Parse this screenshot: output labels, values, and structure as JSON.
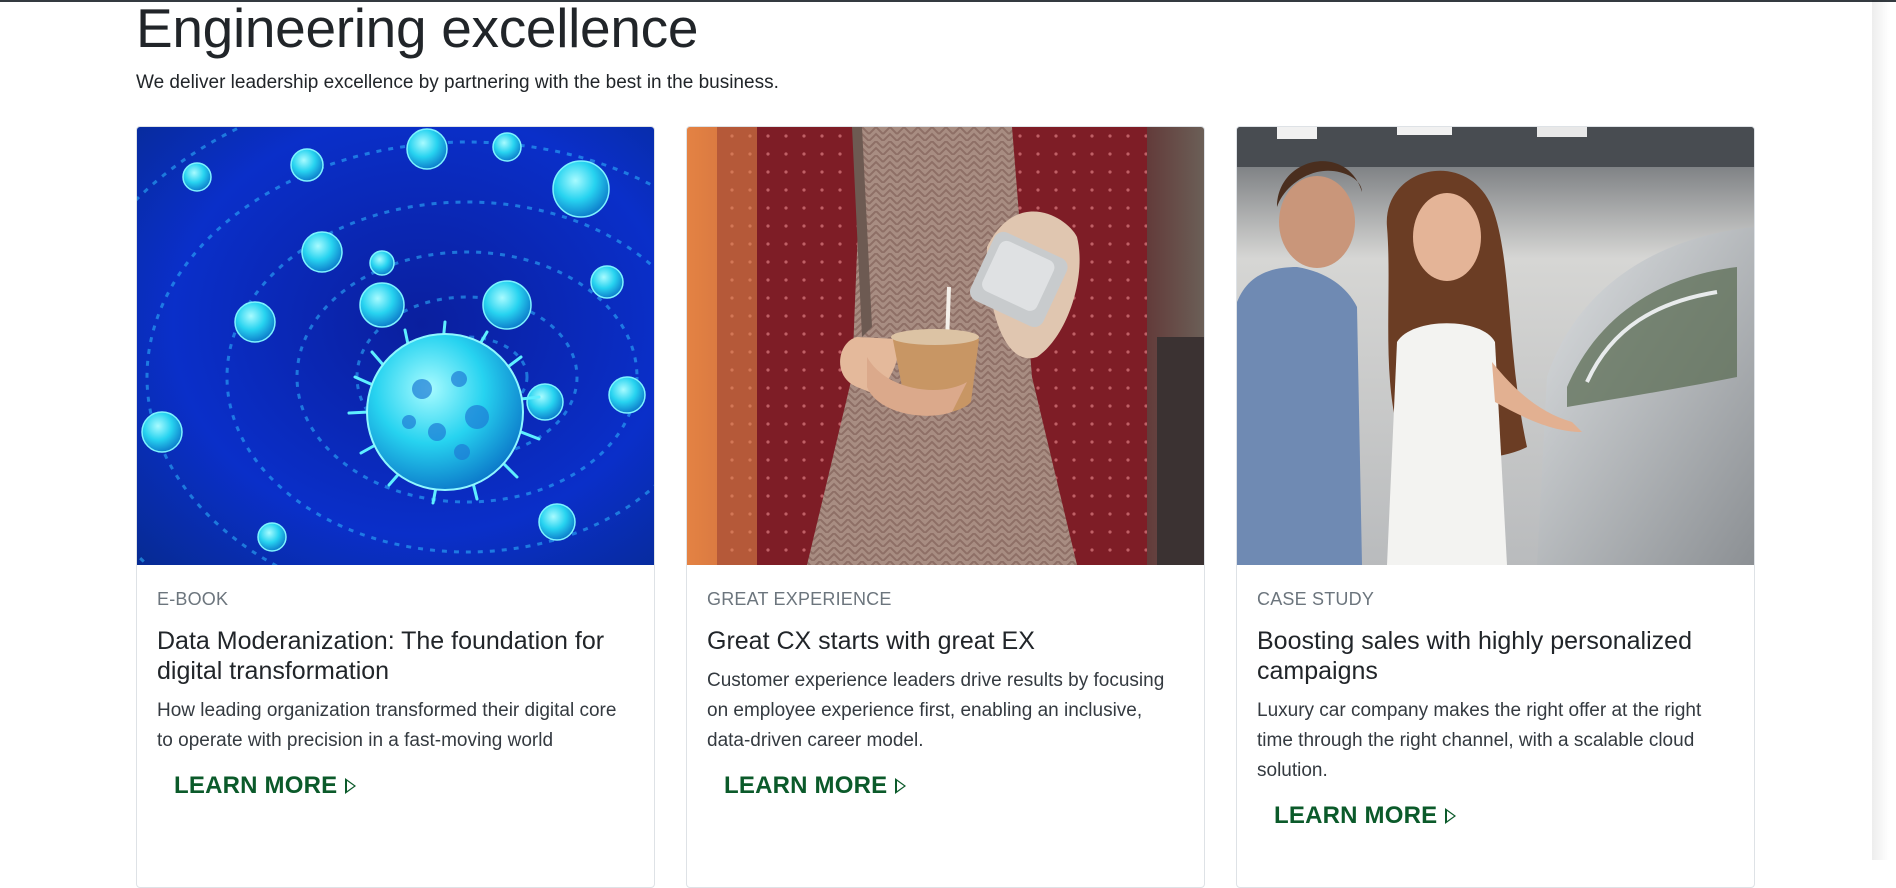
{
  "section": {
    "title": "Engineering excellence",
    "subtitle": "We deliver leadership excellence by partnering with the best in the business."
  },
  "cards": [
    {
      "kicker": "E-BOOK",
      "headline": "Data Moderanization: The foundation for digital transformation",
      "description": "How leading organization transformed their digital core to operate with precision in a fast-moving world",
      "cta": "LEARN MORE",
      "image_subject": "virus-particles-image"
    },
    {
      "kicker": "GREAT EXPERIENCE",
      "headline": "Great CX starts with great EX",
      "description": "Customer experience leaders drive results by focusing on employee experience first, enabling an inclusive, data-driven career model.",
      "cta": "LEARN MORE",
      "image_subject": "barista-pouring-milk-image"
    },
    {
      "kicker": "CASE STUDY",
      "headline": "Boosting sales with highly personalized campaigns",
      "description": "Luxury car company makes the right offer at the right time through the right channel, with a scalable cloud solution.",
      "cta": "LEARN MORE",
      "image_subject": "couple-at-car-dealership-image"
    }
  ],
  "colors": {
    "cta": "#0b5a2a",
    "kicker": "#6c757d",
    "text": "#212529",
    "border": "#dee2e6"
  }
}
